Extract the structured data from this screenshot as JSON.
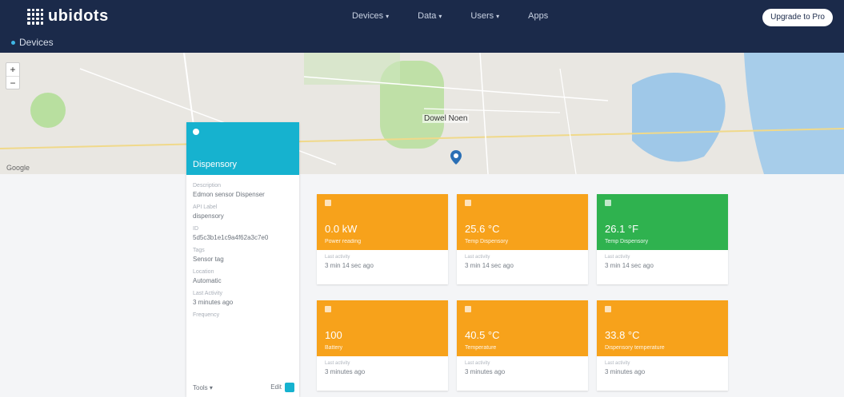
{
  "header": {
    "logo_text": "ubidots",
    "nav": [
      {
        "label": "Devices"
      },
      {
        "label": "Data"
      },
      {
        "label": "Users"
      },
      {
        "label": "Apps"
      }
    ],
    "upgrade_label": "Upgrade to Pro",
    "breadcrumb": "Devices"
  },
  "map": {
    "label": "Dowel Noen",
    "provider": "Google",
    "zoom_in": "+",
    "zoom_out": "−"
  },
  "device": {
    "name": "Dispensory",
    "props": [
      {
        "label": "Description",
        "value": "Edmon sensor Dispenser"
      },
      {
        "label": "API Label",
        "value": "dispensory"
      },
      {
        "label": "ID",
        "value": "5d5c3b1e1c9a4f62a3c7e0"
      },
      {
        "label": "Tags",
        "value": "Sensor tag"
      },
      {
        "label": "Location",
        "value": "Automatic"
      },
      {
        "label": "Last Activity",
        "value": "3 minutes ago"
      },
      {
        "label": "Frequency",
        "value": ""
      }
    ],
    "footer_left": "Tools",
    "footer_right": "Edit"
  },
  "colors": {
    "orange": "#f7a21b",
    "green": "#2fb24f",
    "cyan": "#16b2cf",
    "navy": "#1b2a4a"
  },
  "variables": [
    {
      "value": "0.0 kW",
      "name": "Power reading",
      "color": "#f7a21b",
      "footer_label": "Last activity",
      "footer_value": "3 min 14 sec ago"
    },
    {
      "value": "25.6 °C",
      "name": "Temp Dispensory",
      "color": "#f7a21b",
      "footer_label": "Last activity",
      "footer_value": "3 min 14 sec ago"
    },
    {
      "value": "26.1 °F",
      "name": "Temp Dispensory",
      "color": "#2fb24f",
      "footer_label": "Last activity",
      "footer_value": "3 min 14 sec ago"
    },
    {
      "value": "100",
      "name": "Battery",
      "color": "#f7a21b",
      "footer_label": "Last activity",
      "footer_value": "3 minutes ago"
    },
    {
      "value": "40.5 °C",
      "name": "Temperature",
      "color": "#f7a21b",
      "footer_label": "Last activity",
      "footer_value": "3 minutes ago"
    },
    {
      "value": "33.8 °C",
      "name": "Dispensory temperature",
      "color": "#f7a21b",
      "footer_label": "Last activity",
      "footer_value": "3 minutes ago"
    }
  ]
}
